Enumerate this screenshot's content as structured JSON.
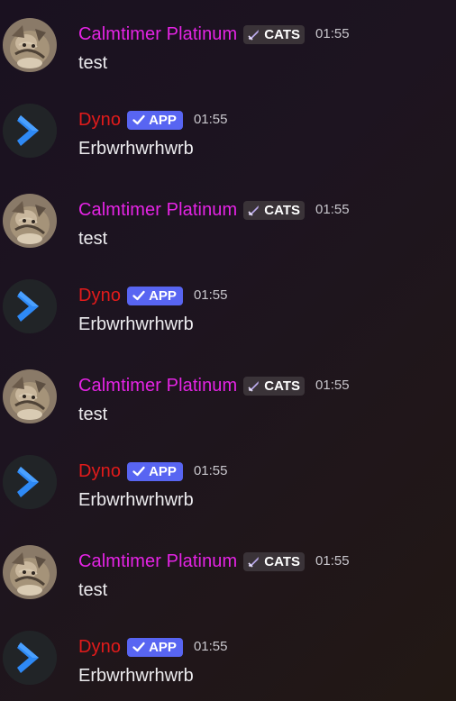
{
  "colors": {
    "calmtimer_name": "#e524e5",
    "dyno_name": "#e21b1b",
    "app_badge": "#5865f2",
    "guild_badge": "#3a3338",
    "timestamp": "#c8c6cc",
    "dyno_avatar_bg": "#212427",
    "dyno_logo": "#2e89f5"
  },
  "messages": [
    {
      "author": "Calmtimer Platinum",
      "badge_label": "CATS",
      "badge_icon": "sword-icon",
      "time": "01:55",
      "text": "test"
    },
    {
      "author": "Dyno",
      "badge_label": "APP",
      "badge_icon": "checkmark-icon",
      "time": "01:55",
      "text": "Erbwrhwrhwrb"
    },
    {
      "author": "Calmtimer Platinum",
      "badge_label": "CATS",
      "badge_icon": "sword-icon",
      "time": "01:55",
      "text": "test"
    },
    {
      "author": "Dyno",
      "badge_label": "APP",
      "badge_icon": "checkmark-icon",
      "time": "01:55",
      "text": "Erbwrhwrhwrb"
    },
    {
      "author": "Calmtimer Platinum",
      "badge_label": "CATS",
      "badge_icon": "sword-icon",
      "time": "01:55",
      "text": "test"
    },
    {
      "author": "Dyno",
      "badge_label": "APP",
      "badge_icon": "checkmark-icon",
      "time": "01:55",
      "text": "Erbwrhwrhwrb"
    },
    {
      "author": "Calmtimer Platinum",
      "badge_label": "CATS",
      "badge_icon": "sword-icon",
      "time": "01:55",
      "text": "test"
    },
    {
      "author": "Dyno",
      "badge_label": "APP",
      "badge_icon": "checkmark-icon",
      "time": "01:55",
      "text": "Erbwrhwrhwrb"
    }
  ]
}
